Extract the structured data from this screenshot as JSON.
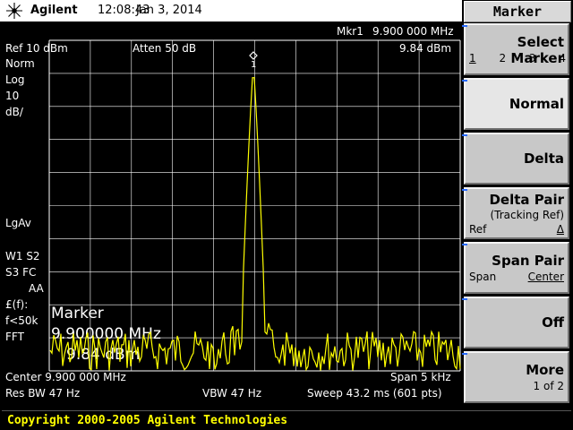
{
  "header": {
    "brand": "Agilent",
    "time": "12:08:43",
    "date": "Jan 3, 2014"
  },
  "marker_readout": {
    "id": "Mkr1",
    "freq": "9.900 000 MHz",
    "level": "9.84 dBm"
  },
  "left_annotations": {
    "ref": "Ref 10 dBm",
    "atten": "Atten 50 dB",
    "norm": "Norm",
    "log": "Log",
    "scale_val": "10",
    "scale_unit": "dB/",
    "avg": "LgAv",
    "w1s2": "W1  S2",
    "s3fc": "S3  FC",
    "aa": "AA",
    "fpound": "£(f):",
    "fk50k": "f<50k",
    "fft": "FFT",
    "marker_title": "Marker",
    "marker_freq": "9.900000 MHz",
    "marker_level": "9.84 dBm",
    "marker_number": "1"
  },
  "bottom_annotations": {
    "center": "Center  9.900 000 MHz",
    "span": "Span 5 kHz",
    "res_bw": "Res BW 47 Hz",
    "vbw": "VBW 47 Hz",
    "sweep": "Sweep 43.2 ms (601 pts)"
  },
  "softkeys": {
    "title": "Marker",
    "select_marker": {
      "label": "Select Marker",
      "options": [
        "1",
        "2",
        "3",
        "4"
      ]
    },
    "normal": {
      "label": "Normal"
    },
    "delta": {
      "label": "Delta"
    },
    "delta_pair": {
      "label": "Delta Pair",
      "sub": "(Tracking Ref)",
      "left": "Ref",
      "right": "Δ"
    },
    "span_pair": {
      "label": "Span Pair",
      "left": "Span",
      "right": "Center"
    },
    "off": {
      "label": "Off"
    },
    "more": {
      "label": "More",
      "sub": "1 of 2"
    }
  },
  "status": {
    "copyright": "Copyright 2000-2005 Agilent Technologies"
  },
  "colors": {
    "trace": "#ffff00",
    "graticule": "#ffffff",
    "softkey_bg": "#c8c8c8",
    "status_text": "#ffff00"
  },
  "icons": {
    "brand": "agilent-spark-icon",
    "marker_diamond": "marker-diamond-icon"
  }
}
